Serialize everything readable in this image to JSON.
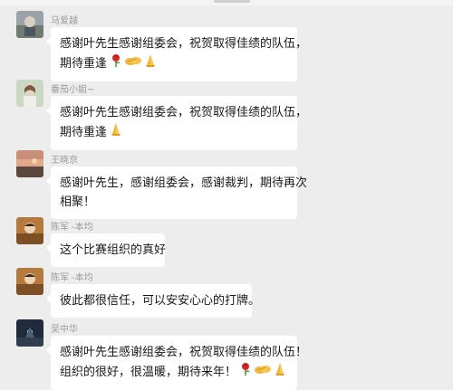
{
  "messages": [
    {
      "sender": "马爱越",
      "lines": [
        "感谢叶先生感谢组委会，祝贺取得佳绩的队伍，",
        "期待重逢"
      ],
      "emojis": [
        "rose-icon",
        "handshake-icon",
        "pray-icon"
      ]
    },
    {
      "sender": "番茄小姐~",
      "lines": [
        "感谢叶先生感谢组委会，祝贺取得佳绩的队伍，",
        "期待重逢"
      ],
      "emojis": [
        "pray-icon"
      ]
    },
    {
      "sender": "王晓京",
      "lines": [
        "感谢叶先生，感谢组委会，感谢裁判，期待再次",
        "相聚！"
      ],
      "emojis": []
    },
    {
      "sender": "陈军 -本均",
      "lines": [
        "这个比赛组织的真好"
      ],
      "emojis": []
    },
    {
      "sender": "陈军 -本均",
      "lines": [
        "彼此都很信任，可以安安心心的打牌。"
      ],
      "emojis": []
    },
    {
      "sender": "吴中华",
      "lines": [
        "感谢叶先生感谢组委会，祝贺取得佳绩的队伍！",
        "组织的很好，很温暖，期待来年！"
      ],
      "emojis": [
        "rose-icon",
        "handshake-icon",
        "pray-icon"
      ]
    }
  ]
}
